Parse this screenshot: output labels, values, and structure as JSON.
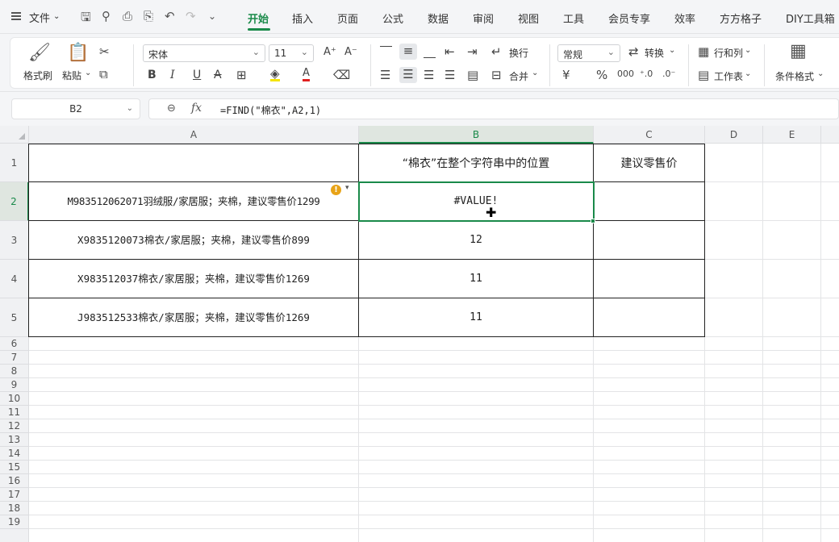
{
  "menubar": {
    "file_label": "文件",
    "tabs": [
      "开始",
      "插入",
      "页面",
      "公式",
      "数据",
      "审阅",
      "视图",
      "工具",
      "会员专享",
      "效率",
      "方方格子",
      "DIY工具箱"
    ],
    "active_tab": "开始"
  },
  "ribbon": {
    "format_painter": "格式刷",
    "paste": "粘贴",
    "font_name": "宋体",
    "font_size": "11",
    "wrap": "换行",
    "merge": "合并",
    "number_format": "常规",
    "convert": "转换",
    "rows_cols": "行和列",
    "worksheet": "工作表",
    "conditional_format": "条件格式"
  },
  "formula_bar": {
    "name_box": "B2",
    "formula": "=FIND(\"棉衣\",A2,1)"
  },
  "columns": [
    "A",
    "B",
    "C",
    "D",
    "E"
  ],
  "rows": [
    "1",
    "2",
    "3",
    "4",
    "5",
    "6",
    "7",
    "8",
    "9",
    "10",
    "11",
    "12",
    "13",
    "14",
    "15",
    "16",
    "17",
    "18",
    "19"
  ],
  "table": {
    "header_b": "“棉衣”在整个字符串中的位置",
    "header_c": "建议零售价",
    "a2": "M983512062071羽绒服/家居服；夹棉，建议零售价1299",
    "a3": "X9835120073棉衣/家居服；夹棉，建议零售价899",
    "a4": "X983512037棉衣/家居服；夹棉，建议零售价1269",
    "a5": "J983512533棉衣/家居服；夹棉，建议零售价1269",
    "b2": "#VALUE!",
    "b3": "12",
    "b4": "11",
    "b5": "11"
  },
  "colors": {
    "accent": "#1a8a4a",
    "warning": "#e8a317"
  }
}
